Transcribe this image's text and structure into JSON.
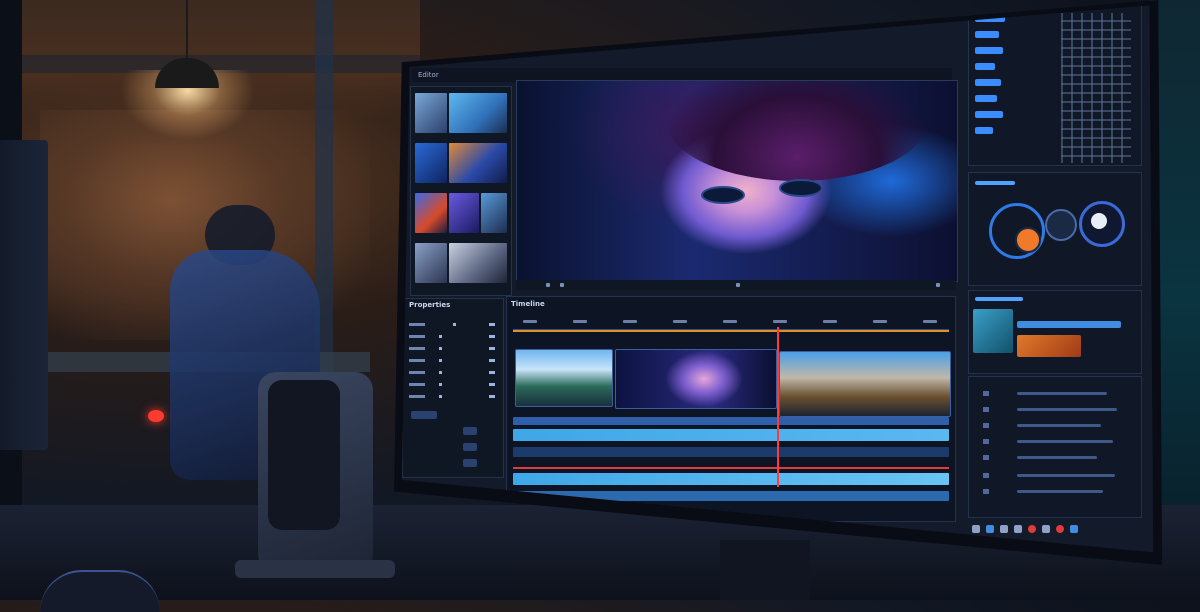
{
  "editor": {
    "titlebar": [
      "Editor",
      "",
      "",
      ""
    ],
    "timeline_title": "Timeline",
    "inspector_title": "Properties",
    "panel_label_scopes": "",
    "panel_label_color": "",
    "panel_label_info": ""
  },
  "colors": {
    "accent": "#4fa2ff",
    "playhead": "#ff3a3a",
    "ruler_marker": "#e0902a",
    "audio_track": "#3fa7e8"
  },
  "icons": [
    "pendant-lamp",
    "speaker",
    "mouse",
    "color-wheel",
    "settings"
  ]
}
